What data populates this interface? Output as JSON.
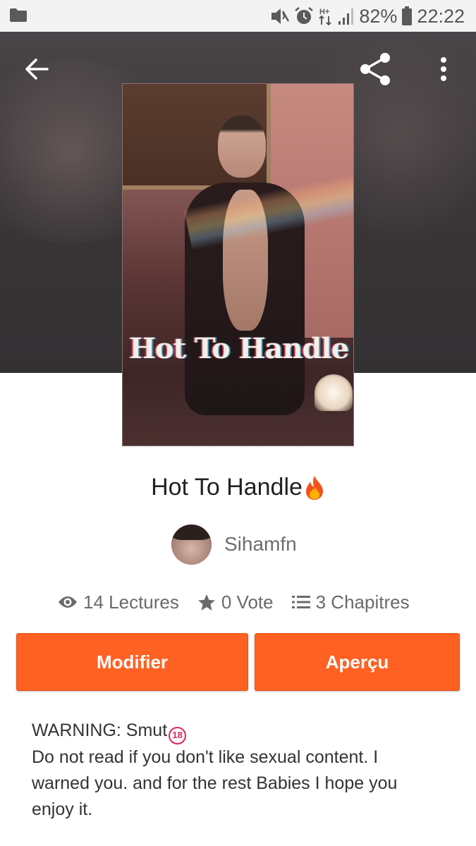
{
  "status_bar": {
    "battery": "82%",
    "time": "22:22",
    "network": "H+",
    "icons": [
      "folder-icon",
      "mute-icon",
      "alarm-icon",
      "data-arrows-icon",
      "signal-icon",
      "battery-icon"
    ]
  },
  "toolbar": {
    "icons": [
      "back-arrow-icon",
      "share-icon",
      "more-vert-icon"
    ]
  },
  "cover": {
    "title_text": "Hot To Handle"
  },
  "story": {
    "title": "Hot To Handle",
    "title_emoji": "fire-icon",
    "author": "Sihamfn"
  },
  "stats": {
    "reads": "14 Lectures",
    "votes": "0 Vote",
    "chapters": "3 Chapitres"
  },
  "buttons": {
    "edit": "Modifier",
    "preview": "Aperçu"
  },
  "description": {
    "line1": "WARNING: Smut",
    "badge": "18",
    "line2": "Do not read if you don't like sexual content. I",
    "line3": "warned you. and for the rest Babies I hope you",
    "line4": "enjoy it."
  },
  "colors": {
    "accent": "#ff6122",
    "status_bar_bg": "#f3f3f3",
    "header_bg": "#3a3638",
    "badge": "#e0245e"
  }
}
